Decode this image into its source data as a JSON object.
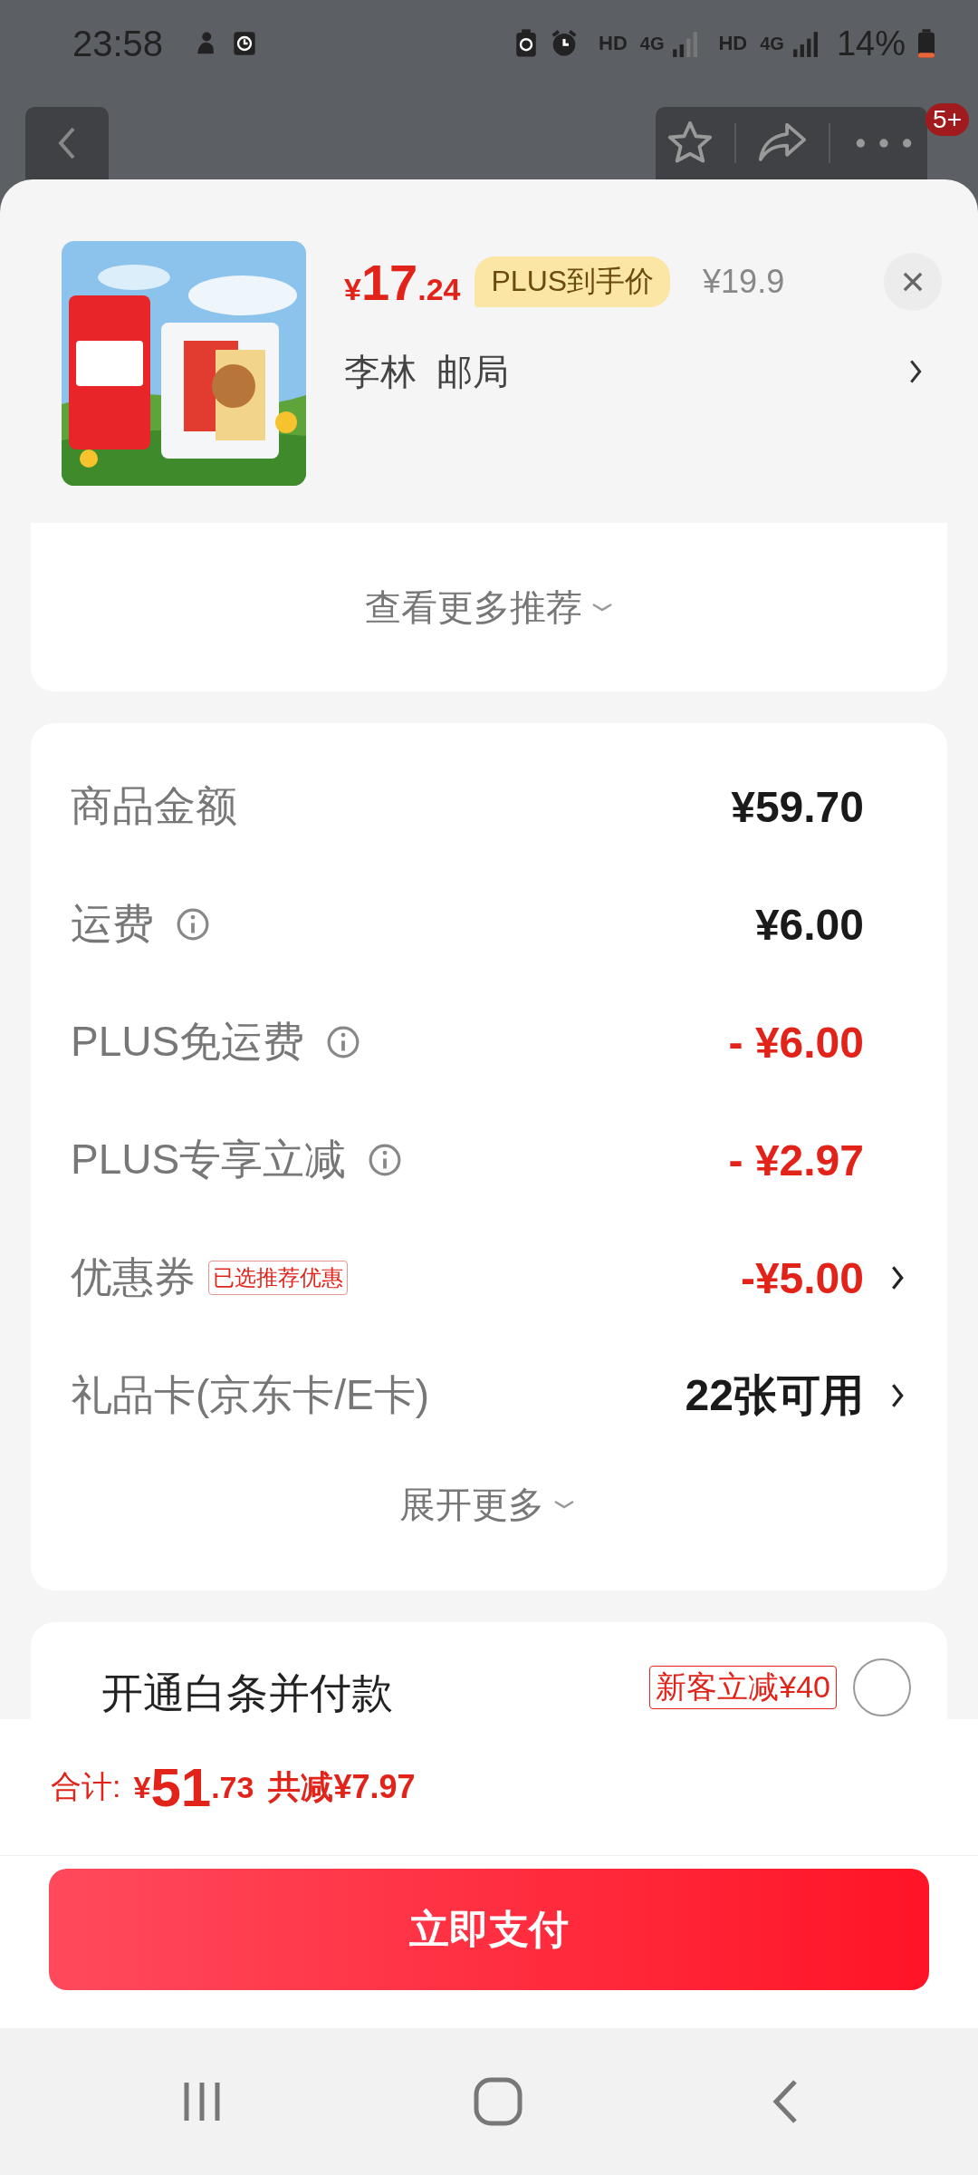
{
  "status_bar": {
    "time": "23:58",
    "network": [
      {
        "label": "HD",
        "tech": "4G"
      },
      {
        "label": "HD",
        "tech": "4G"
      }
    ],
    "battery": "14%"
  },
  "top_nav": {
    "badge": "5+"
  },
  "product": {
    "currency": "¥",
    "price_main": "17",
    "price_decimal": ".24",
    "price_tag": "PLUS到手价",
    "original_price": "¥19.9",
    "address": "李林  邮局"
  },
  "recommend": {
    "label": "查看更多推荐"
  },
  "summary_rows": [
    {
      "label": "商品金额",
      "info": false,
      "value": "¥59.70",
      "discount": false,
      "chevron": false
    },
    {
      "label": "运费",
      "info": true,
      "value": "¥6.00",
      "discount": false,
      "chevron": false
    },
    {
      "label": "PLUS免运费",
      "info": true,
      "value": "- ¥6.00",
      "discount": true,
      "chevron": false
    },
    {
      "label": "PLUS专享立减",
      "info": true,
      "value": "- ¥2.97",
      "discount": true,
      "chevron": false
    },
    {
      "label": "优惠券",
      "info": false,
      "tag": "已选推荐优惠",
      "value": "-¥5.00",
      "discount": true,
      "chevron": true
    },
    {
      "label": "礼品卡(京东卡/E卡)",
      "info": false,
      "value": "22张可用",
      "discount": false,
      "chevron": true
    }
  ],
  "expand": "展开更多",
  "baitiao": {
    "label": "开通白条并付款",
    "promo": "新客立减¥40",
    "selected": false
  },
  "footer": {
    "total_label": "合计:",
    "currency": "¥",
    "total_main": "51",
    "total_decimal": ".73",
    "saving": "共减¥7.97",
    "pay_button": "立即支付"
  }
}
